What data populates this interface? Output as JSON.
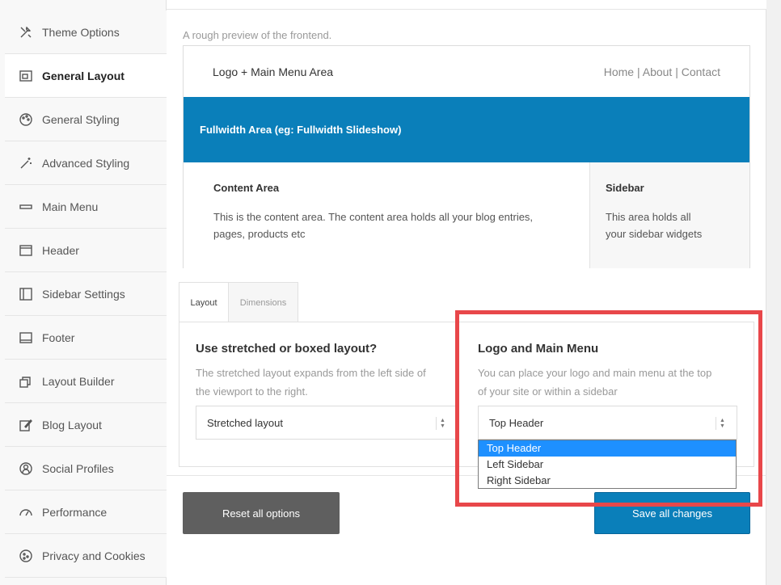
{
  "sidebar": {
    "items": [
      {
        "label": "Theme Options",
        "icon": "wrench-screwdriver-icon",
        "active": false
      },
      {
        "label": "General Layout",
        "icon": "layout-icon",
        "active": true
      },
      {
        "label": "General Styling",
        "icon": "palette-icon",
        "active": false
      },
      {
        "label": "Advanced Styling",
        "icon": "magic-wand-icon",
        "active": false
      },
      {
        "label": "Main Menu",
        "icon": "menu-bar-icon",
        "active": false
      },
      {
        "label": "Header",
        "icon": "header-icon",
        "active": false
      },
      {
        "label": "Sidebar Settings",
        "icon": "sidebar-icon",
        "active": false
      },
      {
        "label": "Footer",
        "icon": "footer-icon",
        "active": false
      },
      {
        "label": "Layout Builder",
        "icon": "layers-icon",
        "active": false
      },
      {
        "label": "Blog Layout",
        "icon": "edit-icon",
        "active": false
      },
      {
        "label": "Social Profiles",
        "icon": "profile-icon",
        "active": false
      },
      {
        "label": "Performance",
        "icon": "gauge-icon",
        "active": false
      },
      {
        "label": "Privacy and Cookies",
        "icon": "cookie-icon",
        "active": false
      }
    ]
  },
  "preview": {
    "caption": "A rough preview of the frontend.",
    "logo_area": "Logo + Main Menu Area",
    "nav": "Home | About | Contact",
    "fullwidth": "Fullwidth Area (eg: Fullwidth Slideshow)",
    "content_title": "Content Area",
    "content_line1": "This is the content area. The content area holds all your blog entries,",
    "content_line2": "pages, products etc",
    "sidebar_title": "Sidebar",
    "sidebar_line1": "This area holds all",
    "sidebar_line2": "your sidebar widgets"
  },
  "tabs": [
    {
      "label": "Layout",
      "active": true
    },
    {
      "label": "Dimensions",
      "active": false
    }
  ],
  "layout_option": {
    "title": "Use stretched or boxed layout?",
    "desc_line1": "The stretched layout expands from the left side of",
    "desc_line2": "the viewport to the right.",
    "value": "Stretched layout"
  },
  "menu_option": {
    "title": "Logo and Main Menu",
    "desc_line1": "You can place your logo and main menu at the top",
    "desc_line2": "of your site or within a sidebar",
    "value": "Top Header",
    "options": [
      "Top Header",
      "Left Sidebar",
      "Right Sidebar"
    ]
  },
  "buttons": {
    "reset": "Reset all options",
    "save": "Save all changes"
  },
  "colors": {
    "accent": "#0a7fba",
    "highlight": "#e8474a",
    "dropdown_selected": "#1e90ff",
    "reset_button": "#5f5f5f"
  }
}
